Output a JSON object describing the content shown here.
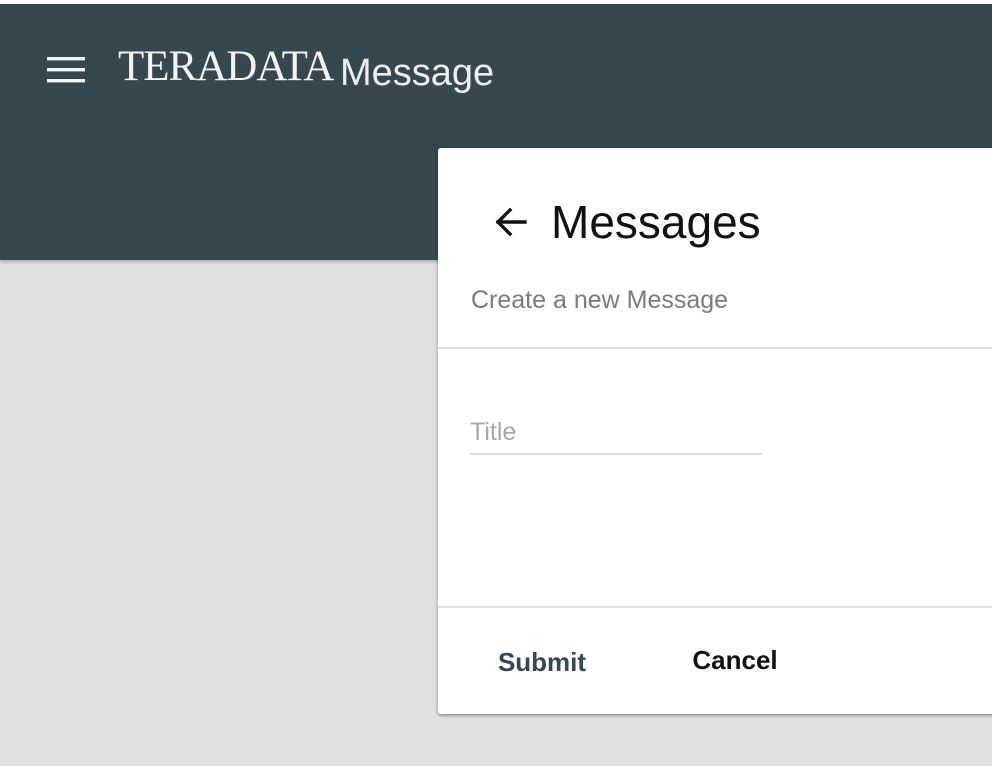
{
  "header": {
    "brand_logo": "TERADATA",
    "app_title": "Message"
  },
  "card": {
    "title": "Messages",
    "subtitle": "Create a new Message",
    "title_field": {
      "placeholder": "Title",
      "value": ""
    },
    "actions": {
      "submit_label": "Submit",
      "cancel_label": "Cancel"
    }
  },
  "icons": {
    "menu": "menu-icon",
    "back": "arrow-back-icon"
  },
  "colors": {
    "toolbar": "#37474f",
    "background": "#e0e0e0",
    "card": "#ffffff",
    "primary_action": "#37474f"
  }
}
